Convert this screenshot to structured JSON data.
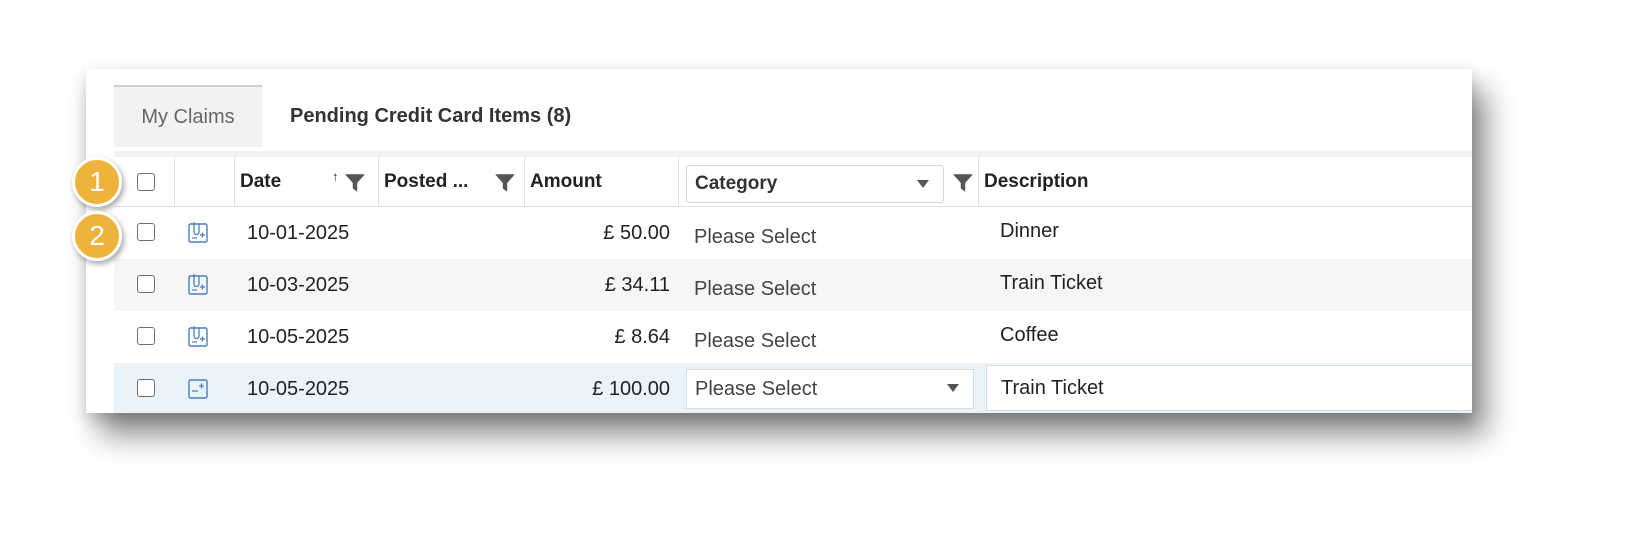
{
  "tabs": [
    {
      "label": "My Claims"
    },
    {
      "label": "Pending Credit Card Items (8)"
    }
  ],
  "table": {
    "headers": {
      "date": "Date",
      "date_sort": "↑",
      "posted": "Posted ...",
      "amount": "Amount",
      "category": "Category",
      "description": "Description"
    },
    "rows": [
      {
        "date": "10-01-2025",
        "amount": "£ 50.00",
        "category": "Please Select",
        "description": "Dinner",
        "icon": "receipt-attached-icon"
      },
      {
        "date": "10-03-2025",
        "amount": "£ 34.11",
        "category": "Please Select",
        "description": "Train Ticket",
        "icon": "receipt-attached-icon"
      },
      {
        "date": "10-05-2025",
        "amount": "£ 8.64",
        "category": "Please Select",
        "description": "Coffee",
        "icon": "receipt-attached-icon"
      },
      {
        "date": "10-05-2025",
        "amount": "£ 100.00",
        "category": "Please Select",
        "description": "Train Ticket",
        "icon": "add-receipt-icon"
      }
    ]
  },
  "callouts": [
    "1",
    "2"
  ],
  "colors": {
    "callout": "#eeb33b",
    "selected_row": "#eaf2fa",
    "icon": "#4a7fb8"
  }
}
